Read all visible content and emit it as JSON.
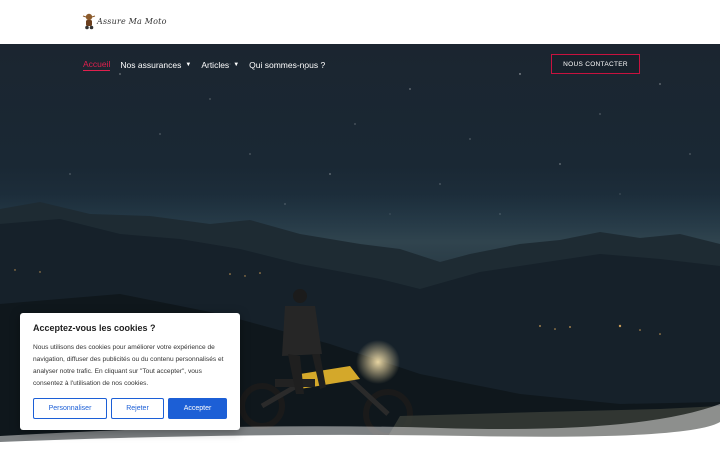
{
  "site": {
    "logo_text": "Assure Ma Moto"
  },
  "nav": {
    "items": [
      {
        "label": "Accueil",
        "active": true,
        "dropdown": false
      },
      {
        "label": "Nos assurances",
        "active": false,
        "dropdown": true
      },
      {
        "label": "Articles",
        "active": false,
        "dropdown": true
      },
      {
        "label": "Qui sommes-nous ?",
        "active": false,
        "dropdown": false
      }
    ],
    "contact_label": "NOUS CONTACTER"
  },
  "cookie": {
    "title": "Acceptez-vous les cookies ?",
    "text": "Nous utilisons des cookies pour améliorer votre expérience de navigation, diffuser des publicités ou du contenu personnalisés et analyser notre trafic. En cliquant sur \"Tout accepter\", vous consentez à l'utilisation de nos cookies.",
    "buttons": {
      "customize": "Personnaliser",
      "reject": "Rejeter",
      "accept": "Accepter"
    }
  },
  "colors": {
    "accent": "#e0204e",
    "primary_button": "#1c5fd6"
  },
  "icons": {
    "dropdown": "caret-down-icon"
  }
}
